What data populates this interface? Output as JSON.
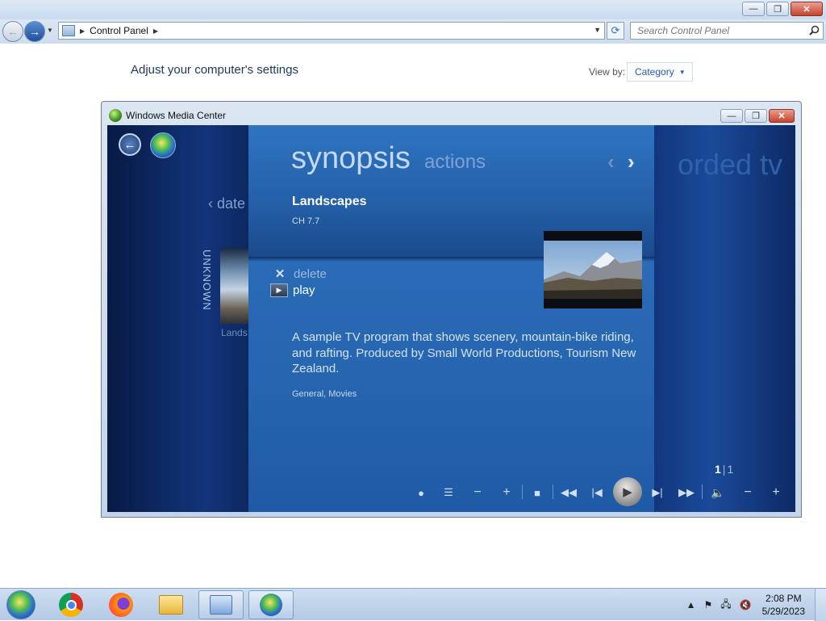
{
  "explorer": {
    "window_buttons": {
      "minimize": "—",
      "restore": "❐",
      "close": "✕"
    },
    "address": {
      "location": "Control Panel"
    },
    "search": {
      "placeholder": "Search Control Panel"
    },
    "heading": "Adjust your computer's settings",
    "view_by_label": "View by:",
    "view_by_value": "Category"
  },
  "media_center": {
    "window_title": "Windows Media Center",
    "background_heading": "orded tv",
    "left_panel": {
      "group_label": "date",
      "vertical_label": "UNKNOWN",
      "item_label": "Lands"
    },
    "tabs": {
      "active": "synopsis",
      "inactive": "actions"
    },
    "program": {
      "title": "Landscapes",
      "channel": "CH 7.7",
      "description": "A sample TV program that shows scenery, mountain-bike riding, and rafting. Produced by Small World Productions, Tourism New Zealand.",
      "genre": "General, Movies"
    },
    "actions": [
      {
        "label": "delete",
        "icon": "close-icon"
      },
      {
        "label": "play",
        "icon": "play-icon"
      }
    ],
    "page": {
      "current": "1",
      "separator": "|",
      "total": "1"
    },
    "transport": [
      "record-icon",
      "list-icon",
      "minus-icon",
      "plus-icon",
      "stop-icon",
      "rewind-icon",
      "skip-back-icon",
      "play-icon",
      "skip-forward-icon",
      "fast-forward-icon",
      "volume-icon",
      "volume-down-icon",
      "volume-up-icon"
    ]
  },
  "taskbar": {
    "items": [
      "start",
      "chrome",
      "firefox",
      "file-explorer",
      "control-panel",
      "windows-media-center"
    ],
    "clock": {
      "time": "2:08 PM",
      "date": "5/29/2023"
    }
  }
}
